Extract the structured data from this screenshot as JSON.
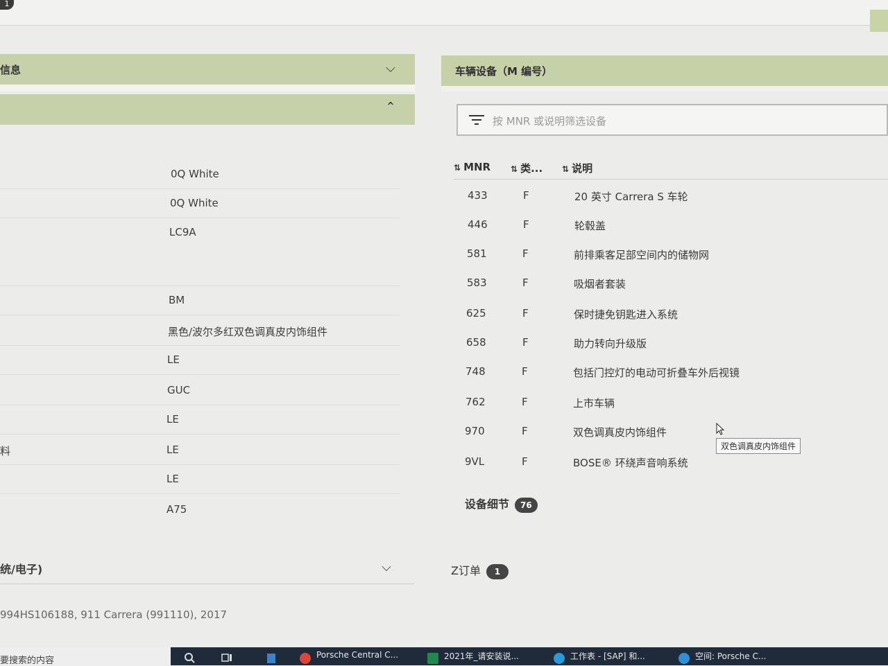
{
  "top_badge": "1",
  "left_panel": {
    "section1_title": "信息",
    "rows": [
      {
        "label": "",
        "value": "0Q White"
      },
      {
        "label": "",
        "value": "0Q White"
      },
      {
        "label": "",
        "value": "LC9A"
      },
      {
        "label": "",
        "value": "BM"
      },
      {
        "label": "",
        "value": "黑色/波尔多红双色调真皮内饰组件"
      },
      {
        "label": "",
        "value": "LE"
      },
      {
        "label": "",
        "value": "GUC"
      },
      {
        "label": "",
        "value": "LE"
      },
      {
        "label": "料",
        "value": "LE"
      },
      {
        "label": "",
        "value": "LE"
      },
      {
        "label": "",
        "value": "A75"
      }
    ],
    "bottom_section_title": "统/电子)",
    "vehicle_line": "994HS106188, 911 Carrera (991110), 2017"
  },
  "right_panel": {
    "title": "车辆设备（M 编号）",
    "filter_placeholder": "按 MNR 或说明筛选设备",
    "columns": {
      "mnr": "MNR",
      "type": "类...",
      "desc": "说明"
    },
    "rows": [
      {
        "mnr": "433",
        "type": "F",
        "desc": "20 英寸 Carrera S 车轮"
      },
      {
        "mnr": "446",
        "type": "F",
        "desc": "轮毂盖"
      },
      {
        "mnr": "581",
        "type": "F",
        "desc": "前排乘客足部空间内的储物网"
      },
      {
        "mnr": "583",
        "type": "F",
        "desc": "吸烟者套装"
      },
      {
        "mnr": "625",
        "type": "F",
        "desc": "保时捷免钥匙进入系统"
      },
      {
        "mnr": "658",
        "type": "F",
        "desc": "助力转向升级版"
      },
      {
        "mnr": "748",
        "type": "F",
        "desc": "包括门控灯的电动可折叠车外后视镜"
      },
      {
        "mnr": "762",
        "type": "F",
        "desc": "上市车辆"
      },
      {
        "mnr": "970",
        "type": "F",
        "desc": "双色调真皮内饰组件"
      },
      {
        "mnr": "9VL",
        "type": "F",
        "desc": "BOSE® 环绕声音响系统"
      }
    ],
    "details_label": "设备细节",
    "details_count": "76",
    "zorder_label": "Z订单",
    "zorder_count": "1",
    "tooltip": "双色调真皮内饰组件"
  },
  "taskbar": {
    "search_text": "要搜索的内容",
    "items": [
      "Porsche Central C...",
      "2021年_请安装说...",
      "工作表 - [SAP] 和...",
      "空间: Porsche C..."
    ]
  },
  "colors": {
    "section_header": "#c6d0a9",
    "badge": "#454545",
    "taskbar": "#1f2b3a"
  }
}
